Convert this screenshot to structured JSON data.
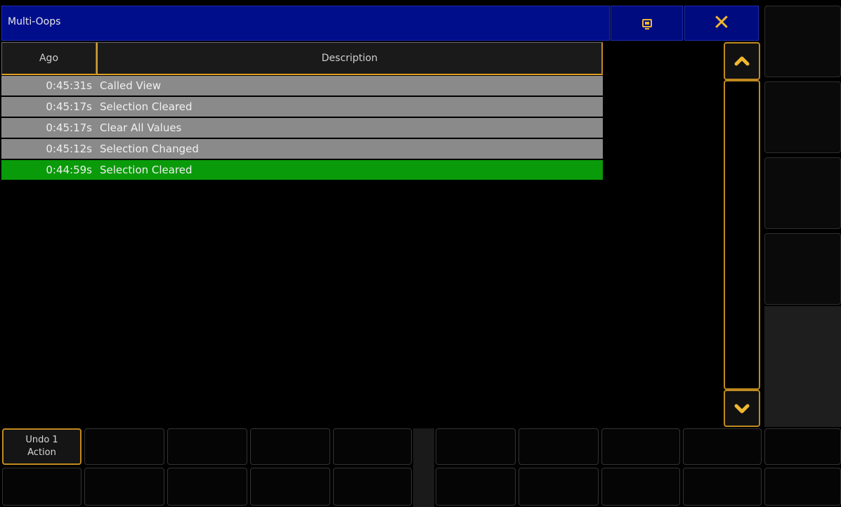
{
  "window": {
    "title": "Multi-Oops"
  },
  "toolbar": {
    "screen_icon": "screen-icon",
    "close_icon": "close-icon",
    "close_glyph": "✕",
    "accent_color": "#f0b830"
  },
  "table": {
    "columns": [
      "Ago",
      "Description"
    ],
    "rows": [
      {
        "ago": "0:45:31s",
        "description": "Called View",
        "selected": false
      },
      {
        "ago": "0:45:17s",
        "description": "Selection Cleared",
        "selected": false
      },
      {
        "ago": "0:45:17s",
        "description": "Clear All Values",
        "selected": false
      },
      {
        "ago": "0:45:12s",
        "description": "Selection Changed",
        "selected": false
      },
      {
        "ago": "0:44:59s",
        "description": "Selection Cleared",
        "selected": true
      }
    ]
  },
  "scrollbar": {
    "up_icon": "chevron-up-icon",
    "down_icon": "chevron-down-icon"
  },
  "bottom_buttons": {
    "undo_label": "Undo 1\nAction"
  },
  "colors": {
    "title_bar": "#000e8c",
    "row_normal": "#8a8a8a",
    "row_selected": "#0a9b0a",
    "border_accent": "#c08a20"
  }
}
